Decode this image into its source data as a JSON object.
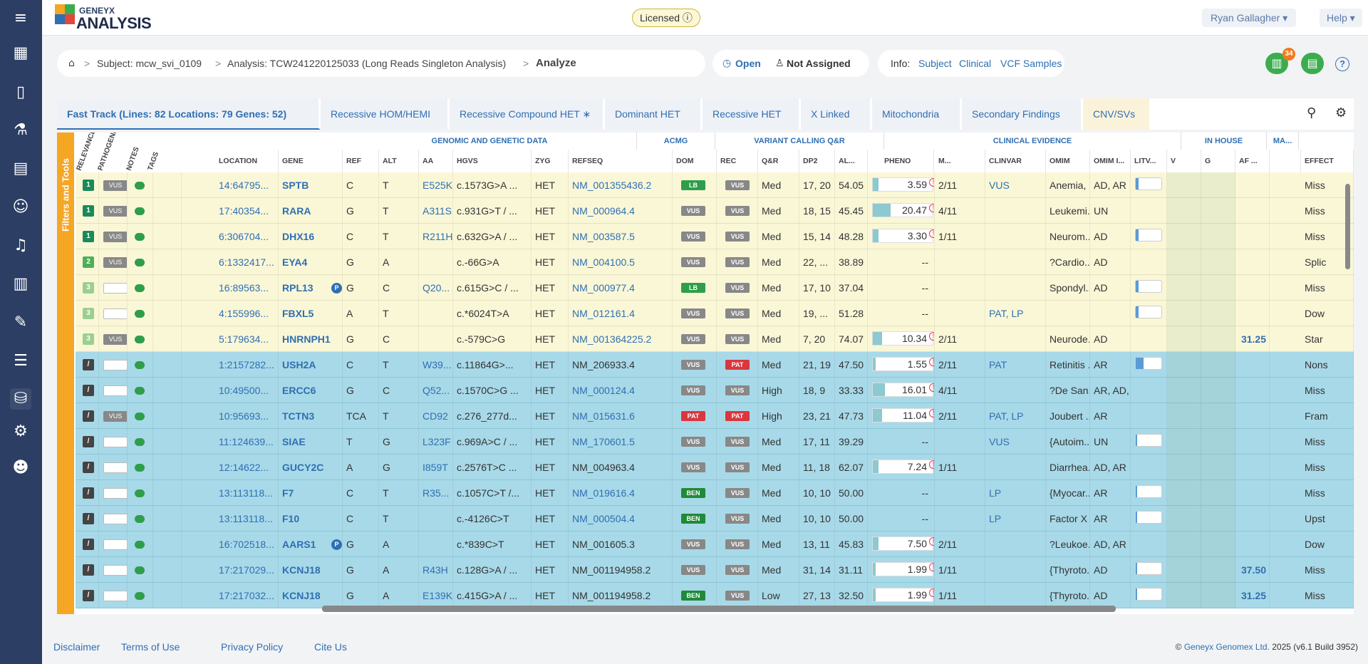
{
  "app": {
    "brand_small": "GENEYX",
    "brand_main": "ANALYSIS",
    "licensed": "Licensed ⓘ",
    "user": "Ryan Gallagher ▾",
    "help": "Help ▾",
    "notifications_count": "34"
  },
  "breadcrumb": {
    "subject": "Subject: mcw_svi_0109",
    "analysis": "Analysis: TCW241220125033 (Long Reads Singleton Analysis)",
    "current": "Analyze"
  },
  "status": {
    "open": "Open",
    "assigned": "Not Assigned"
  },
  "info": {
    "label": "Info:",
    "links": [
      "Subject",
      "Clinical",
      "VCF Samples"
    ]
  },
  "tabs": [
    {
      "label": "Fast Track    (Lines: 82   Locations: 79   Genes: 52)"
    },
    {
      "label": "Recessive HOM/HEMI"
    },
    {
      "label": "Recessive Compound HET   ∗"
    },
    {
      "label": "Dominant HET"
    },
    {
      "label": "Recessive HET"
    },
    {
      "label": "X Linked"
    },
    {
      "label": "Mitochondria"
    },
    {
      "label": "Secondary Findings"
    },
    {
      "label": "CNV/SVs"
    }
  ],
  "filters_label": "Filters and Tools",
  "group_headers": [
    "GENOMIC AND GENETIC DATA",
    "ACMG",
    "VARIANT CALLING Q&R",
    "CLINICAL EVIDENCE",
    "IN HOUSE",
    "MA..."
  ],
  "rotated_headers": [
    "RELEVANCE",
    "PATHOGENIC",
    "NOTES",
    "TAGS"
  ],
  "columns": [
    "LOCATION",
    "GENE",
    "REF",
    "ALT",
    "AA",
    "HGVS",
    "ZYG",
    "REFSEQ",
    "DOM",
    "REC",
    "Q&R",
    "DP2",
    "AL...",
    "PHENO",
    "M...",
    "CLINVAR",
    "OMIM",
    "OMIM I...",
    "LITV...",
    "V",
    "G",
    "AF ...",
    "",
    "EFFECT"
  ],
  "rows": [
    {
      "color": "yellow",
      "rel": "1",
      "rel_color": "#1b8a5a",
      "path": "VUS",
      "loc": "14:64795...",
      "gene": "SPTB",
      "ref": "C",
      "alt": "T",
      "aa": "E525K",
      "hgvs": "c.1573G>A ...",
      "zyg": "HET",
      "refseq": "NM_001355436.2",
      "refseq_link": true,
      "dom": "LB",
      "dom_c": "#2e9e4a",
      "rec": "VUS",
      "rec_c": "#888",
      "qr": "Med",
      "dp": "17, 20",
      "al": "54.05",
      "pheno": "3.59",
      "pheno_frac": 0.1,
      "m": "2/11",
      "clinvar": "VUS",
      "omim": "Anemia, ...",
      "omimi": "AD, AR",
      "litv": 0.1,
      "af": "",
      "effect": "Miss",
      "pb": false
    },
    {
      "color": "yellow",
      "rel": "1",
      "rel_color": "#1b8a5a",
      "path": "VUS",
      "loc": "17:40354...",
      "gene": "RARA",
      "ref": "G",
      "alt": "T",
      "aa": "A311S",
      "hgvs": "c.931G>T / ...",
      "zyg": "HET",
      "refseq": "NM_000964.4",
      "refseq_link": true,
      "dom": "VUS",
      "dom_c": "#888",
      "rec": "VUS",
      "rec_c": "#888",
      "qr": "Med",
      "dp": "18, 15",
      "al": "45.45",
      "pheno": "20.47",
      "pheno_frac": 0.3,
      "m": "4/11",
      "clinvar": "",
      "omim": "Leukemi...",
      "omimi": "UN",
      "litv": -1,
      "af": "",
      "effect": "Miss",
      "pb": false
    },
    {
      "color": "yellow",
      "rel": "1",
      "rel_color": "#1b8a5a",
      "path": "VUS",
      "loc": "6:306704...",
      "gene": "DHX16",
      "ref": "C",
      "alt": "T",
      "aa": "R211H",
      "hgvs": "c.632G>A / ...",
      "zyg": "HET",
      "refseq": "NM_003587.5",
      "refseq_link": true,
      "dom": "VUS",
      "dom_c": "#888",
      "rec": "VUS",
      "rec_c": "#888",
      "qr": "Med",
      "dp": "15, 14",
      "al": "48.28",
      "pheno": "3.30",
      "pheno_frac": 0.1,
      "m": "1/11",
      "clinvar": "",
      "omim": "Neurom...",
      "omimi": "AD",
      "litv": 0.1,
      "af": "",
      "effect": "Miss",
      "pb": false
    },
    {
      "color": "yellow",
      "rel": "2",
      "rel_color": "#4fae58",
      "path": "VUS",
      "loc": "6:1332417...",
      "gene": "EYA4",
      "ref": "G",
      "alt": "A",
      "aa": "",
      "hgvs": "c.-66G>A",
      "zyg": "HET",
      "refseq": "NM_004100.5",
      "refseq_link": true,
      "dom": "VUS",
      "dom_c": "#888",
      "rec": "VUS",
      "rec_c": "#888",
      "qr": "Med",
      "dp": "22, ...",
      "al": "38.89",
      "pheno": "--",
      "pheno_frac": -1,
      "m": "",
      "clinvar": "",
      "omim": "?Cardio...",
      "omimi": "AD",
      "litv": -1,
      "af": "",
      "effect": "Splic",
      "pb": false
    },
    {
      "color": "yellow",
      "rel": "3",
      "rel_color": "#9ccf8e",
      "path": "",
      "loc": "16:89563...",
      "gene": "RPL13",
      "ref": "G",
      "alt": "C",
      "aa": "Q20...",
      "hgvs": "c.615G>C / ...",
      "zyg": "HET",
      "refseq": "NM_000977.4",
      "refseq_link": true,
      "dom": "LB",
      "dom_c": "#2e9e4a",
      "rec": "VUS",
      "rec_c": "#888",
      "qr": "Med",
      "dp": "17, 10",
      "al": "37.04",
      "pheno": "--",
      "pheno_frac": -1,
      "m": "",
      "clinvar": "",
      "omim": "Spondyl...",
      "omimi": "AD",
      "litv": 0.1,
      "af": "",
      "effect": "Miss",
      "pb": true
    },
    {
      "color": "yellow",
      "rel": "3",
      "rel_color": "#9ccf8e",
      "path": "",
      "loc": "4:155996...",
      "gene": "FBXL5",
      "ref": "A",
      "alt": "T",
      "aa": "",
      "hgvs": "c.*6024T>A",
      "zyg": "HET",
      "refseq": "NM_012161.4",
      "refseq_link": true,
      "dom": "VUS",
      "dom_c": "#888",
      "rec": "VUS",
      "rec_c": "#888",
      "qr": "Med",
      "dp": "19, ...",
      "al": "51.28",
      "pheno": "--",
      "pheno_frac": -1,
      "m": "",
      "clinvar": "PAT, LP",
      "omim": "",
      "omimi": "",
      "litv": 0.1,
      "af": "",
      "effect": "Dow",
      "pb": false
    },
    {
      "color": "yellow",
      "rel": "3",
      "rel_color": "#9ccf8e",
      "path": "VUS",
      "loc": "5:179634...",
      "gene": "HNRNPH1",
      "ref": "G",
      "alt": "C",
      "aa": "",
      "hgvs": "c.-579C>G",
      "zyg": "HET",
      "refseq": "NM_001364225.2",
      "refseq_link": true,
      "dom": "VUS",
      "dom_c": "#888",
      "rec": "VUS",
      "rec_c": "#888",
      "qr": "Med",
      "dp": "7, 20",
      "al": "74.07",
      "pheno": "10.34",
      "pheno_frac": 0.15,
      "m": "2/11",
      "clinvar": "",
      "omim": "Neurode...",
      "omimi": "AD",
      "litv": -1,
      "af": "31.25",
      "effect": "Star",
      "pb": false
    },
    {
      "color": "blue",
      "rel": "/",
      "rel_color": "#444",
      "path": "",
      "loc": "1:2157282...",
      "gene": "USH2A",
      "ref": "C",
      "alt": "T",
      "aa": "W39...",
      "hgvs": "c.11864G>...",
      "zyg": "HET",
      "refseq": "NM_206933.4",
      "refseq_link": false,
      "dom": "VUS",
      "dom_c": "#888",
      "rec": "PAT",
      "rec_c": "#d9363e",
      "qr": "Med",
      "dp": "21, 19",
      "al": "47.50",
      "pheno": "1.55",
      "pheno_frac": 0.05,
      "m": "2/11",
      "clinvar": "PAT",
      "omim": "Retinitis ...",
      "omimi": "AR",
      "litv": 0.3,
      "af": "",
      "effect": "Nons",
      "pb": false
    },
    {
      "color": "blue",
      "rel": "/",
      "rel_color": "#444",
      "path": "",
      "loc": "10:49500...",
      "gene": "ERCC6",
      "ref": "G",
      "alt": "C",
      "aa": "Q52...",
      "hgvs": "c.1570C>G ...",
      "zyg": "HET",
      "refseq": "NM_000124.4",
      "refseq_link": true,
      "dom": "VUS",
      "dom_c": "#888",
      "rec": "VUS",
      "rec_c": "#888",
      "qr": "High",
      "dp": "18, 9",
      "al": "33.33",
      "pheno": "16.01",
      "pheno_frac": 0.2,
      "m": "4/11",
      "clinvar": "",
      "omim": "?De San...",
      "omimi": "AR, AD, ...",
      "litv": -1,
      "af": "",
      "effect": "Miss",
      "pb": false
    },
    {
      "color": "blue",
      "rel": "/",
      "rel_color": "#444",
      "path": "VUS",
      "loc": "10:95693...",
      "gene": "TCTN3",
      "ref": "TCA",
      "alt": "T",
      "aa": "CD92",
      "hgvs": "c.276_277d...",
      "zyg": "HET",
      "refseq": "NM_015631.6",
      "refseq_link": true,
      "dom": "PAT",
      "dom_c": "#d9363e",
      "rec": "PAT",
      "rec_c": "#d9363e",
      "qr": "High",
      "dp": "23, 21",
      "al": "47.73",
      "pheno": "11.04",
      "pheno_frac": 0.15,
      "m": "2/11",
      "clinvar": "PAT, LP",
      "omim": "Joubert ...",
      "omimi": "AR",
      "litv": -1,
      "af": "",
      "effect": "Fram",
      "pb": false
    },
    {
      "color": "blue",
      "rel": "/",
      "rel_color": "#444",
      "path": "",
      "loc": "11:124639...",
      "gene": "SIAE",
      "ref": "T",
      "alt": "G",
      "aa": "L323F",
      "hgvs": "c.969A>C / ...",
      "zyg": "HET",
      "refseq": "NM_170601.5",
      "refseq_link": true,
      "dom": "VUS",
      "dom_c": "#888",
      "rec": "VUS",
      "rec_c": "#888",
      "qr": "Med",
      "dp": "17, 11",
      "al": "39.29",
      "pheno": "--",
      "pheno_frac": -1,
      "m": "",
      "clinvar": "VUS",
      "omim": "{Autoim...",
      "omimi": "UN",
      "litv": 0.0,
      "af": "",
      "effect": "Miss",
      "pb": false
    },
    {
      "color": "blue",
      "rel": "/",
      "rel_color": "#444",
      "path": "",
      "loc": "12:14622...",
      "gene": "GUCY2C",
      "ref": "A",
      "alt": "G",
      "aa": "I859T",
      "hgvs": "c.2576T>C ...",
      "zyg": "HET",
      "refseq": "NM_004963.4",
      "refseq_link": false,
      "dom": "VUS",
      "dom_c": "#888",
      "rec": "VUS",
      "rec_c": "#888",
      "qr": "Med",
      "dp": "11, 18",
      "al": "62.07",
      "pheno": "7.24",
      "pheno_frac": 0.1,
      "m": "1/11",
      "clinvar": "",
      "omim": "Diarrhea...",
      "omimi": "AD, AR",
      "litv": -1,
      "af": "",
      "effect": "Miss",
      "pb": false
    },
    {
      "color": "blue",
      "rel": "/",
      "rel_color": "#444",
      "path": "",
      "loc": "13:113118...",
      "gene": "F7",
      "ref": "C",
      "alt": "T",
      "aa": "R35...",
      "hgvs": "c.1057C>T /...",
      "zyg": "HET",
      "refseq": "NM_019616.4",
      "refseq_link": true,
      "dom": "BEN",
      "dom_c": "#1f8a3a",
      "rec": "VUS",
      "rec_c": "#888",
      "qr": "Med",
      "dp": "10, 10",
      "al": "50.00",
      "pheno": "--",
      "pheno_frac": -1,
      "m": "",
      "clinvar": "LP",
      "omim": "{Myocar...",
      "omimi": "AR",
      "litv": 0.0,
      "af": "",
      "effect": "Miss",
      "pb": false
    },
    {
      "color": "blue",
      "rel": "/",
      "rel_color": "#444",
      "path": "",
      "loc": "13:113118...",
      "gene": "F10",
      "ref": "C",
      "alt": "T",
      "aa": "",
      "hgvs": "c.-4126C>T",
      "zyg": "HET",
      "refseq": "NM_000504.4",
      "refseq_link": true,
      "dom": "BEN",
      "dom_c": "#1f8a3a",
      "rec": "VUS",
      "rec_c": "#888",
      "qr": "Med",
      "dp": "10, 10",
      "al": "50.00",
      "pheno": "--",
      "pheno_frac": -1,
      "m": "",
      "clinvar": "LP",
      "omim": "Factor X ...",
      "omimi": "AR",
      "litv": 0.0,
      "af": "",
      "effect": "Upst",
      "pb": false
    },
    {
      "color": "blue",
      "rel": "/",
      "rel_color": "#444",
      "path": "",
      "loc": "16:702518...",
      "gene": "AARS1",
      "ref": "G",
      "alt": "A",
      "aa": "",
      "hgvs": "c.*839C>T",
      "zyg": "HET",
      "refseq": "NM_001605.3",
      "refseq_link": false,
      "dom": "VUS",
      "dom_c": "#888",
      "rec": "VUS",
      "rec_c": "#888",
      "qr": "Med",
      "dp": "13, 11",
      "al": "45.83",
      "pheno": "7.50",
      "pheno_frac": 0.1,
      "m": "2/11",
      "clinvar": "",
      "omim": "?Leukoe...",
      "omimi": "AD, AR",
      "litv": -1,
      "af": "",
      "effect": "Dow",
      "pb": true
    },
    {
      "color": "blue",
      "rel": "/",
      "rel_color": "#444",
      "path": "",
      "loc": "17:217029...",
      "gene": "KCNJ18",
      "ref": "G",
      "alt": "A",
      "aa": "R43H",
      "hgvs": "c.128G>A / ...",
      "zyg": "HET",
      "refseq": "NM_001194958.2",
      "refseq_link": false,
      "dom": "VUS",
      "dom_c": "#888",
      "rec": "VUS",
      "rec_c": "#888",
      "qr": "Med",
      "dp": "31, 14",
      "al": "31.11",
      "pheno": "1.99",
      "pheno_frac": 0.05,
      "m": "1/11",
      "clinvar": "",
      "omim": "{Thyroto...",
      "omimi": "AD",
      "litv": 0.0,
      "af": "37.50",
      "effect": "Miss",
      "pb": false
    },
    {
      "color": "blue",
      "rel": "/",
      "rel_color": "#444",
      "path": "",
      "loc": "17:217032...",
      "gene": "KCNJ18",
      "ref": "G",
      "alt": "A",
      "aa": "E139K",
      "hgvs": "c.415G>A / ...",
      "zyg": "HET",
      "refseq": "NM_001194958.2",
      "refseq_link": false,
      "dom": "BEN",
      "dom_c": "#1f8a3a",
      "rec": "VUS",
      "rec_c": "#888",
      "qr": "Low",
      "dp": "27, 13",
      "al": "32.50",
      "pheno": "1.99",
      "pheno_frac": 0.05,
      "m": "1/11",
      "clinvar": "",
      "omim": "{Thyroto...",
      "omimi": "AD",
      "litv": 0.0,
      "af": "31.25",
      "effect": "Miss",
      "pb": false
    }
  ],
  "footer": {
    "links": [
      "Disclaimer",
      "Terms of Use",
      "Privacy Policy",
      "Cite Us"
    ],
    "copyright_prefix": "© ",
    "company": "Geneyx Genomex Ltd.",
    "copyright_suffix": " 2025 (v6.1 Build 3952)"
  }
}
